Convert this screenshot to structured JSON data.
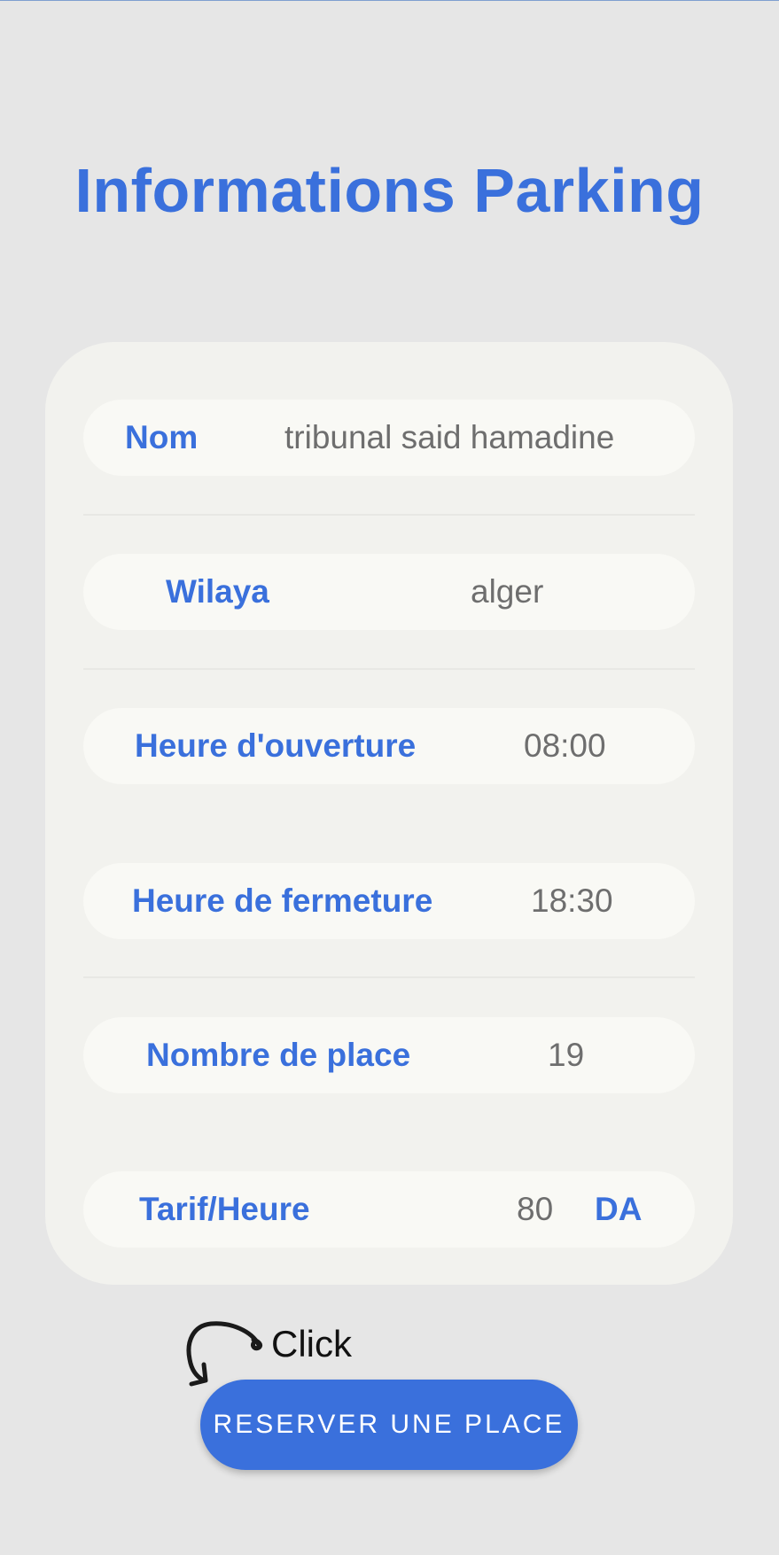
{
  "page": {
    "title": "Informations Parking"
  },
  "info": {
    "nom": {
      "label": "Nom",
      "value": "tribunal said hamadine"
    },
    "wilaya": {
      "label": "Wilaya",
      "value": "alger"
    },
    "ouverture": {
      "label": "Heure d'ouverture",
      "value": "08:00"
    },
    "fermeture": {
      "label": "Heure de fermeture",
      "value": "18:30"
    },
    "places": {
      "label": "Nombre de place",
      "value": "19"
    },
    "tarif": {
      "label": "Tarif/Heure",
      "value": "80",
      "unit": "DA"
    }
  },
  "annotation": {
    "text": "Click",
    "icon": "curved-arrow-icon"
  },
  "actions": {
    "reserve_label": "RESERVER UNE PLACE"
  },
  "colors": {
    "accent": "#3a70dc",
    "background": "#e6e6e6",
    "card": "#f2f2ee",
    "row": "#f9f9f5",
    "value_text": "#6e6e6e"
  }
}
